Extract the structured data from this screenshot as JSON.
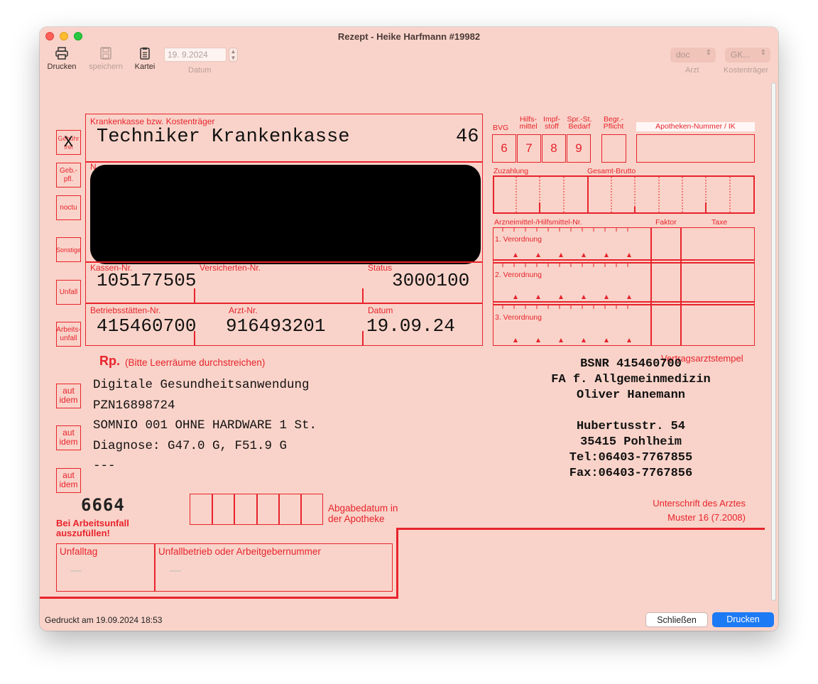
{
  "window": {
    "title": "Rezept -  Heike Harfmann #19982"
  },
  "toolbar": {
    "print_label": "Drucken",
    "save_label": "speichern",
    "kartei_label": "Kartei",
    "date_value": "19. 9.2024",
    "date_label": "Datum",
    "arzt_value": "doc",
    "arzt_label": "Arzt",
    "kostentraeger_value": "GK...",
    "kostentraeger_label": "Kostenträger"
  },
  "form": {
    "side_boxes": [
      "Gebühr frei",
      "Geb.- pfl.",
      "noctu",
      "Sonstige",
      "Unfall",
      "Arbeits- unfall"
    ],
    "gebuehr_mark": "X",
    "kasse_label": "Krankenkasse bzw. Kostenträger",
    "kasse_name": "Techniker Krankenkasse",
    "kasse_code": "46",
    "name_label_fragment": "N",
    "kassen_nr_label": "Kassen-Nr.",
    "kassen_nr": "105177505",
    "versicherten_nr_label": "Versicherten-Nr.",
    "status_label": "Status",
    "status": "3000100",
    "bsnr_label": "Betriebsstätten-Nr.",
    "bsnr": "415460700",
    "arzt_nr_label": "Arzt-Nr.",
    "arzt_nr": "916493201",
    "datum_label": "Datum",
    "datum": "19.09.24",
    "bvg_label": "BVG",
    "hilfsmittel_label": "Hilfs- mittel",
    "impfstoff_label": "Impf- stoff",
    "spr_label": "Spr.-St. Bedarf",
    "begr_label": "Begr.- Pflicht",
    "apotheken_label": "Apotheken-Nummer / IK",
    "num_boxes": [
      "6",
      "7",
      "8",
      "9"
    ],
    "zuzahlung_label": "Zuzahlung",
    "gesamt_label": "Gesamt-Brutto",
    "arznei_label": "Arzneimittel-/Hilfsmittel-Nr.",
    "faktor_label": "Faktor",
    "taxe_label": "Taxe",
    "verordnungen": [
      "1. Verordnung",
      "2. Verordnung",
      "3. Verordnung"
    ],
    "rp_label": "Rp.",
    "rp_hint": "(Bitte Leerräume durchstreichen)",
    "aut_idem": "aut idem",
    "rx_lines": [
      "Digitale Gesundheitsanwendung",
      "PZN16898724",
      "SOMNIO 001 OHNE HARDWARE 1 St.",
      "Diagnose: G47.0 G, F51.9 G",
      "---"
    ],
    "form_code": "6664",
    "abgabe_label": "Abgabedatum in der Apotheke",
    "arbeitsunfall_label": "Bei Arbeitsunfall auszufüllen!",
    "unfalltag_label": "Unfalltag",
    "unfalltag_value": "—",
    "unfallbetrieb_label": "Unfallbetrieb oder Arbeitgebernummer",
    "unfallbetrieb_value": "—",
    "stamp_label": "Vertragsarztstempel",
    "stamp_lines": [
      "BSNR 415460700",
      "FA f. Allgemeinmedizin",
      "Oliver Hanemann",
      "",
      "Hubertusstr. 54",
      "35415 Pohlheim",
      "Tel:06403-7767855",
      "Fax:06403-7767856"
    ],
    "signature_label": "Unterschrift des Arztes",
    "muster_label": "Muster 16 (7.2008)"
  },
  "footer": {
    "printed_text": "Gedruckt am 19.09.2024 18:53",
    "close_label": "Schließen",
    "print_label": "Drucken"
  },
  "colors": {
    "form_red": "#e8232c",
    "background": "#f9d3c9",
    "primary_button": "#1d7af5"
  }
}
